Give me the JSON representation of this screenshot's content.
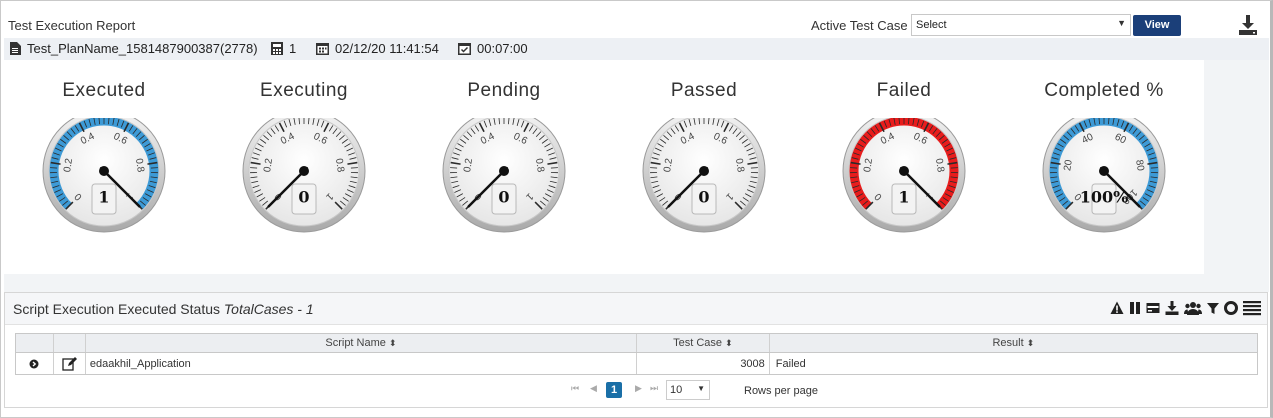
{
  "header": {
    "title": "Test Execution Report",
    "active_test_case_label": "Active Test Case",
    "select_value": "Select",
    "view_label": "View"
  },
  "info": {
    "plan_name": "Test_PlanName_1581487900387(2778)",
    "count": "1",
    "date": "02/12/20 11:41:54",
    "duration": "00:07:00"
  },
  "gauges": [
    {
      "title": "Executed",
      "value": "1",
      "fraction": 1.0,
      "arc": "blue",
      "ticks": [
        "0",
        "0.2",
        "0.4",
        "0.6",
        "0.8",
        "1"
      ]
    },
    {
      "title": "Executing",
      "value": "0",
      "fraction": 0.0,
      "arc": "none",
      "ticks": [
        "0",
        "0.2",
        "0.4",
        "0.6",
        "0.8",
        "1"
      ]
    },
    {
      "title": "Pending",
      "value": "0",
      "fraction": 0.0,
      "arc": "none",
      "ticks": [
        "0",
        "0.2",
        "0.4",
        "0.6",
        "0.8",
        "1"
      ]
    },
    {
      "title": "Passed",
      "value": "0",
      "fraction": 0.0,
      "arc": "none",
      "ticks": [
        "0",
        "0.2",
        "0.4",
        "0.6",
        "0.8",
        "1"
      ]
    },
    {
      "title": "Failed",
      "value": "1",
      "fraction": 1.0,
      "arc": "red",
      "ticks": [
        "0",
        "0.2",
        "0.4",
        "0.6",
        "0.8",
        "1"
      ]
    },
    {
      "title": "Completed %",
      "value": "100",
      "fraction": 1.0,
      "arc": "blue",
      "ticks": [
        "0",
        "20",
        "40",
        "60",
        "80",
        "100"
      ],
      "suffix": "%"
    }
  ],
  "colors": {
    "blue_arc": "#3d9ad6",
    "red_arc": "#e81c1c",
    "brand": "#1b3f79"
  },
  "panel": {
    "title": "Script Execution Executed Status",
    "subtitle": "TotalCases - 1",
    "icons": [
      "warning-icon",
      "pause-icon",
      "card-icon",
      "download-icon",
      "users-icon",
      "filter-icon",
      "circle-icon",
      "list-icon"
    ]
  },
  "table": {
    "columns": [
      "Script Name",
      "Test Case",
      "Result"
    ],
    "rows": [
      {
        "script_name": "edaakhil_Application",
        "test_case": "3008",
        "result": "Failed"
      }
    ]
  },
  "pager": {
    "current_page": "1",
    "rows_per_page": "10",
    "rows_label": "Rows per page"
  }
}
